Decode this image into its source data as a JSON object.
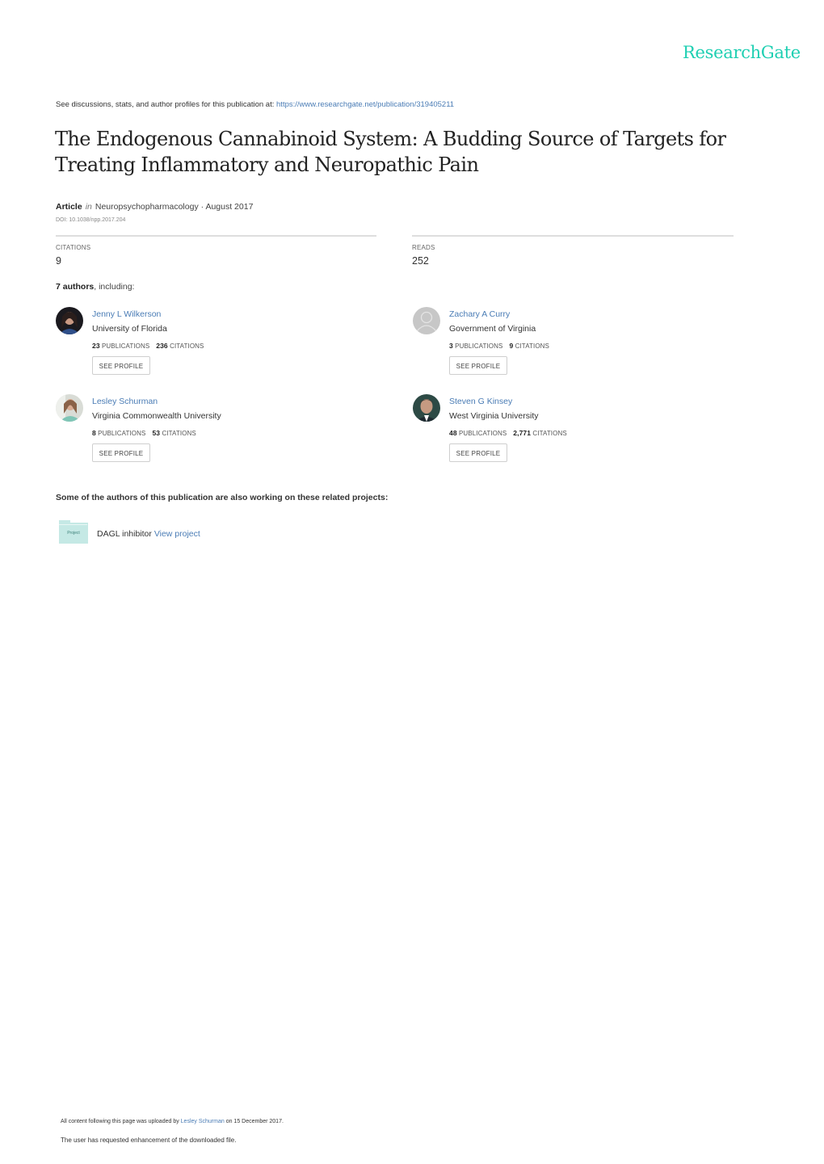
{
  "brand": {
    "name": "ResearchGate",
    "color": "#1ecfb2"
  },
  "header": {
    "discussion_text": "See discussions, stats, and author profiles for this publication at: ",
    "publication_url": "https://www.researchgate.net/publication/319405211"
  },
  "publication": {
    "title": "The Endogenous Cannabinoid System: A Budding Source of Targets for Treating Inflammatory and Neuropathic Pain",
    "type": "Article",
    "in_label": "in",
    "journal_date": "Neuropsychopharmacology · August 2017",
    "doi": "DOI: 10.1038/npp.2017.204"
  },
  "stats": {
    "citations_label": "CITATIONS",
    "citations_value": "9",
    "reads_label": "READS",
    "reads_value": "252"
  },
  "authors_heading": {
    "count": "7 authors",
    "suffix": ", including:"
  },
  "authors": [
    {
      "name": "Jenny L Wilkerson",
      "institution": "University of Florida",
      "publications": "23",
      "publications_label": "PUBLICATIONS",
      "citations": "236",
      "citations_label": "CITATIONS",
      "button": "SEE PROFILE"
    },
    {
      "name": "Zachary A Curry",
      "institution": "Government of Virginia",
      "publications": "3",
      "publications_label": "PUBLICATIONS",
      "citations": "9",
      "citations_label": "CITATIONS",
      "button": "SEE PROFILE"
    },
    {
      "name": "Lesley Schurman",
      "institution": "Virginia Commonwealth University",
      "publications": "8",
      "publications_label": "PUBLICATIONS",
      "citations": "53",
      "citations_label": "CITATIONS",
      "button": "SEE PROFILE"
    },
    {
      "name": "Steven G Kinsey",
      "institution": "West Virginia University",
      "publications": "48",
      "publications_label": "PUBLICATIONS",
      "citations": "2,771",
      "citations_label": "CITATIONS",
      "button": "SEE PROFILE"
    }
  ],
  "related": {
    "heading": "Some of the authors of this publication are also working on these related projects:",
    "projects": [
      {
        "icon_label": "Project",
        "name": "DAGL inhibitor ",
        "link": "View project"
      }
    ]
  },
  "footer": {
    "uploaded_prefix": "All content following this page was uploaded by ",
    "uploader": "Lesley Schurman",
    "uploaded_suffix": " on 15 December 2017.",
    "enhancement_note": "The user has requested enhancement of the downloaded file."
  }
}
